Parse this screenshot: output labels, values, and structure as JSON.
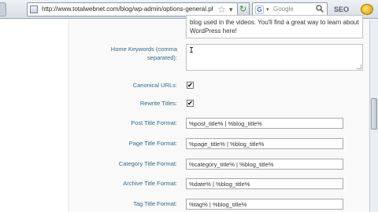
{
  "browser": {
    "url": "http://www.totalwebnet.com/blog/wp-admin/options-general.php?page=all-i",
    "search_placeholder": "Google",
    "search_engine_letter": "G",
    "extension_label": "SEO"
  },
  "description_text": "blog used in the videos.   You'll find a great way to learn about WordPress here!",
  "keywords": {
    "label_line1": "Home Keywords (comma",
    "label_line2": "separated):",
    "value": ""
  },
  "checkboxes": [
    {
      "label": "Canonical URLs:",
      "checked": true
    },
    {
      "label": "Rewrite Titles:",
      "checked": true
    }
  ],
  "formats": [
    {
      "label": "Post Title Format:",
      "value": "%post_title% | %blog_title%"
    },
    {
      "label": "Page Title Format:",
      "value": "%page_title% | %blog_title%"
    },
    {
      "label": "Category Title Format:",
      "value": "%category_title% | %blog_title%"
    },
    {
      "label": "Archive Title Format:",
      "value": "%date% | %blog_title%"
    },
    {
      "label": "Tag Title Format:",
      "value": "%tag% | %blog_title%"
    }
  ],
  "check_mark": "✔",
  "colors": {
    "label_blue": "#2e6b8e",
    "admin_bg": "#f9f9f9"
  }
}
